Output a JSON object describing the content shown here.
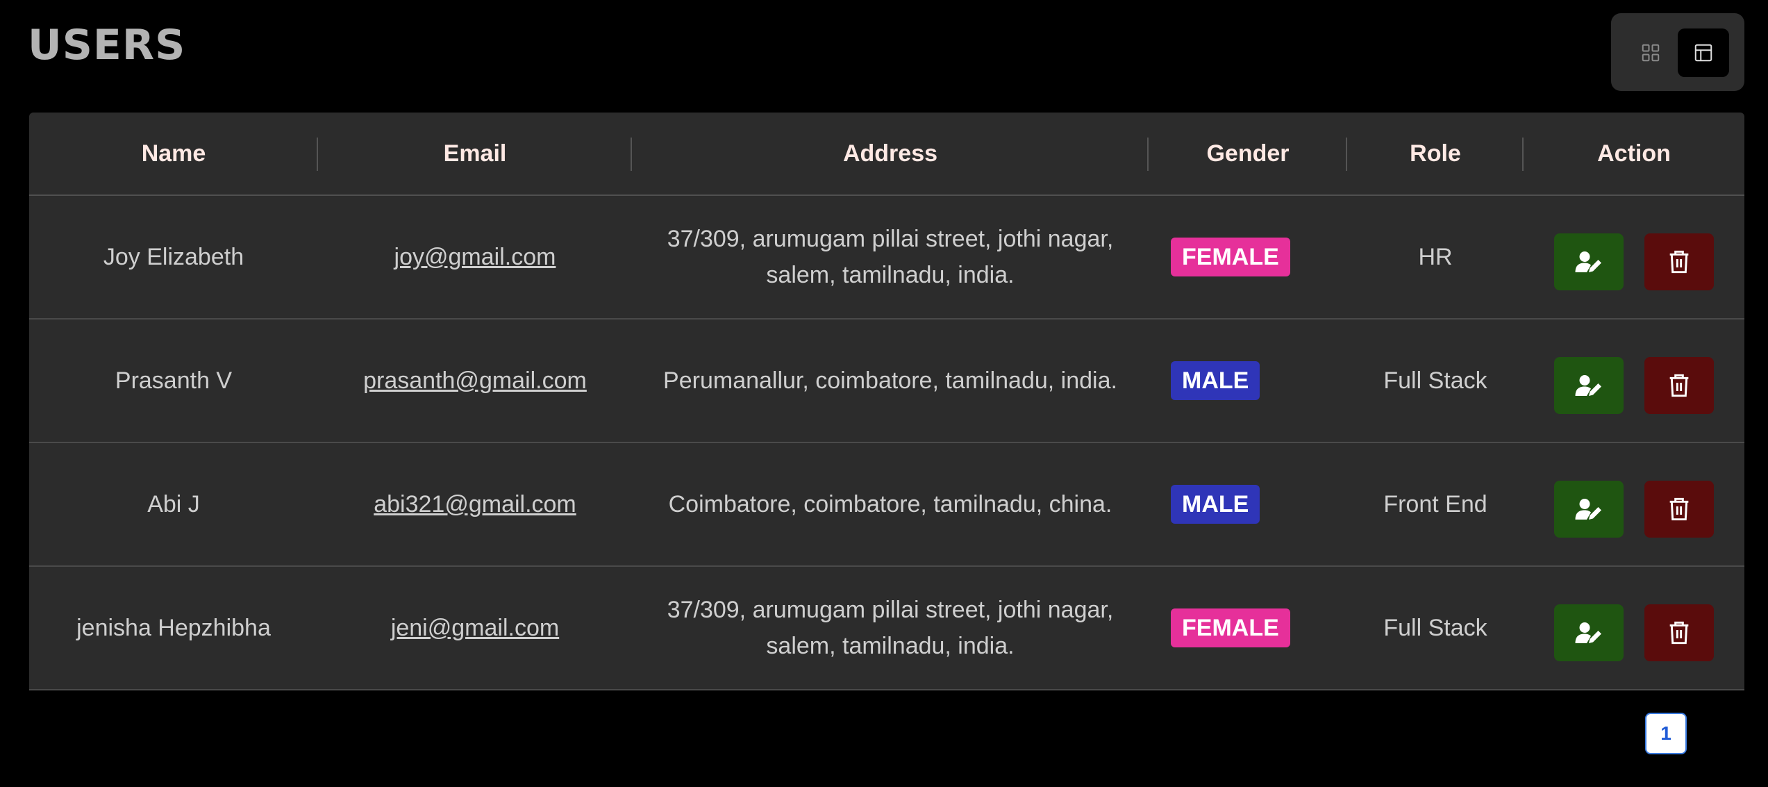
{
  "page": {
    "title": "USERS"
  },
  "view_toggle": {
    "options": [
      {
        "icon": "grid-view-icon",
        "active": false
      },
      {
        "icon": "table-view-icon",
        "active": true
      }
    ]
  },
  "table": {
    "columns": [
      "Name",
      "Email",
      "Address",
      "Gender",
      "Role",
      "Action"
    ],
    "rows": [
      {
        "name": "Joy Elizabeth",
        "email": "joy@gmail.com",
        "address_line1": "37/309, arumugam pillai street, jothi nagar,",
        "address_line2": "salem, tamilnadu, india.",
        "gender": "FEMALE",
        "role": "HR"
      },
      {
        "name": "Prasanth V",
        "email": "prasanth@gmail.com",
        "address_line1": "Perumanallur, coimbatore, tamilnadu, india.",
        "address_line2": "",
        "gender": "MALE",
        "role": "Full Stack"
      },
      {
        "name": "Abi J",
        "email": "abi321@gmail.com",
        "address_line1": "Coimbatore, coimbatore, tamilnadu, china.",
        "address_line2": "",
        "gender": "MALE",
        "role": "Front End"
      },
      {
        "name": "jenisha Hepzhibha",
        "email": "jeni@gmail.com",
        "address_line1": "37/309, arumugam pillai street, jothi nagar,",
        "address_line2": "salem, tamilnadu, india.",
        "gender": "FEMALE",
        "role": "Full Stack"
      }
    ],
    "action_icons": {
      "edit": "user-edit-icon",
      "delete": "trash-icon"
    }
  },
  "pagination": {
    "current_page": "1"
  },
  "colors": {
    "background": "#000000",
    "table_background": "#2c2c2c",
    "female_badge": "#e6309a",
    "male_badge": "#2f35b8",
    "edit_button": "#1f5511",
    "delete_button": "#5a0c0c",
    "pager_border": "#3a7be0"
  }
}
